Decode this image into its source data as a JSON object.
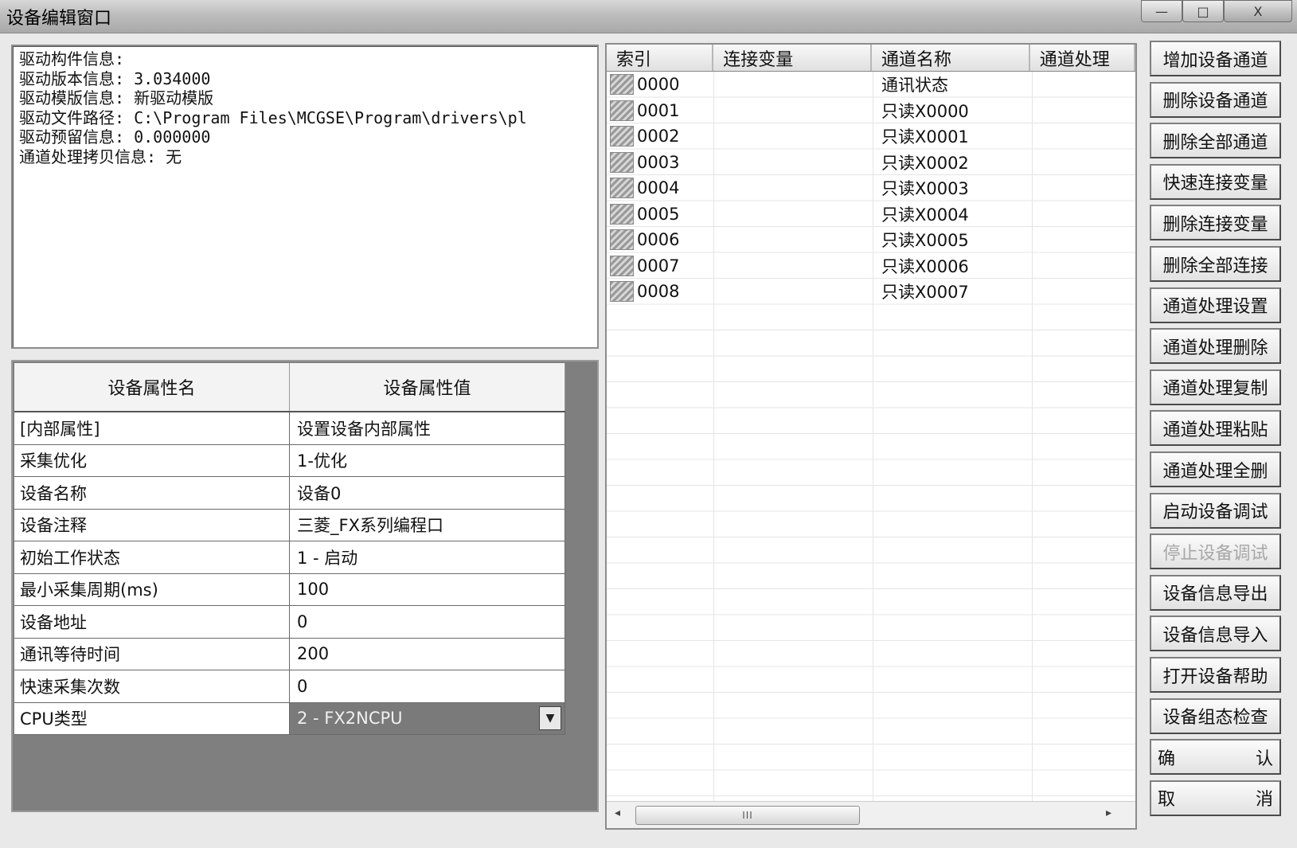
{
  "window": {
    "title": "设备编辑窗口",
    "minimize_glyph": "—",
    "maximize_glyph": "□",
    "close_glyph": "X"
  },
  "info": {
    "lines": [
      "驱动构件信息:",
      "驱动版本信息: 3.034000",
      "驱动模版信息: 新驱动模版",
      "驱动文件路径: C:\\Program Files\\MCGSE\\Program\\drivers\\pl",
      "驱动预留信息: 0.000000",
      "通道处理拷贝信息: 无"
    ]
  },
  "properties": {
    "header_name": "设备属性名",
    "header_value": "设备属性值",
    "rows": [
      {
        "name": "[内部属性]",
        "value": "设置设备内部属性"
      },
      {
        "name": "采集优化",
        "value": "1-优化"
      },
      {
        "name": "设备名称",
        "value": "设备0"
      },
      {
        "name": "设备注释",
        "value": "三菱_FX系列编程口"
      },
      {
        "name": "初始工作状态",
        "value": "1 - 启动"
      },
      {
        "name": "最小采集周期(ms)",
        "value": "100"
      },
      {
        "name": "设备地址",
        "value": "0"
      },
      {
        "name": "通讯等待时间",
        "value": "200"
      },
      {
        "name": "快速采集次数",
        "value": "0"
      },
      {
        "name": "CPU类型",
        "value": "2 - FX2NCPU"
      }
    ],
    "dropdown_glyph": "▼"
  },
  "channels": {
    "headers": [
      "索引",
      "连接变量",
      "通道名称",
      "通道处理"
    ],
    "rows": [
      {
        "index": "0000",
        "variable": "",
        "name": "通讯状态",
        "process": ""
      },
      {
        "index": "0001",
        "variable": "",
        "name": "只读X0000",
        "process": ""
      },
      {
        "index": "0002",
        "variable": "",
        "name": "只读X0001",
        "process": ""
      },
      {
        "index": "0003",
        "variable": "",
        "name": "只读X0002",
        "process": ""
      },
      {
        "index": "0004",
        "variable": "",
        "name": "只读X0003",
        "process": ""
      },
      {
        "index": "0005",
        "variable": "",
        "name": "只读X0004",
        "process": ""
      },
      {
        "index": "0006",
        "variable": "",
        "name": "只读X0005",
        "process": ""
      },
      {
        "index": "0007",
        "variable": "",
        "name": "只读X0006",
        "process": ""
      },
      {
        "index": "0008",
        "variable": "",
        "name": "只读X0007",
        "process": ""
      }
    ],
    "scroll_left": "◂",
    "scroll_right": "▸",
    "scroll_thumb": "III"
  },
  "buttons": [
    {
      "label": "增加设备通道",
      "enabled": true
    },
    {
      "label": "删除设备通道",
      "enabled": true
    },
    {
      "label": "删除全部通道",
      "enabled": true
    },
    {
      "label": "快速连接变量",
      "enabled": true
    },
    {
      "label": "删除连接变量",
      "enabled": true
    },
    {
      "label": "删除全部连接",
      "enabled": true
    },
    {
      "label": "通道处理设置",
      "enabled": true
    },
    {
      "label": "通道处理删除",
      "enabled": true
    },
    {
      "label": "通道处理复制",
      "enabled": true
    },
    {
      "label": "通道处理粘贴",
      "enabled": true
    },
    {
      "label": "通道处理全删",
      "enabled": true
    },
    {
      "label": "启动设备调试",
      "enabled": true
    },
    {
      "label": "停止设备调试",
      "enabled": false
    },
    {
      "label": "设备信息导出",
      "enabled": true
    },
    {
      "label": "设备信息导入",
      "enabled": true
    },
    {
      "label": "打开设备帮助",
      "enabled": true
    },
    {
      "label": "设备组态检查",
      "enabled": true
    }
  ],
  "confirm": {
    "left": "确",
    "right": "认"
  },
  "cancel": {
    "left": "取",
    "right": "消"
  }
}
